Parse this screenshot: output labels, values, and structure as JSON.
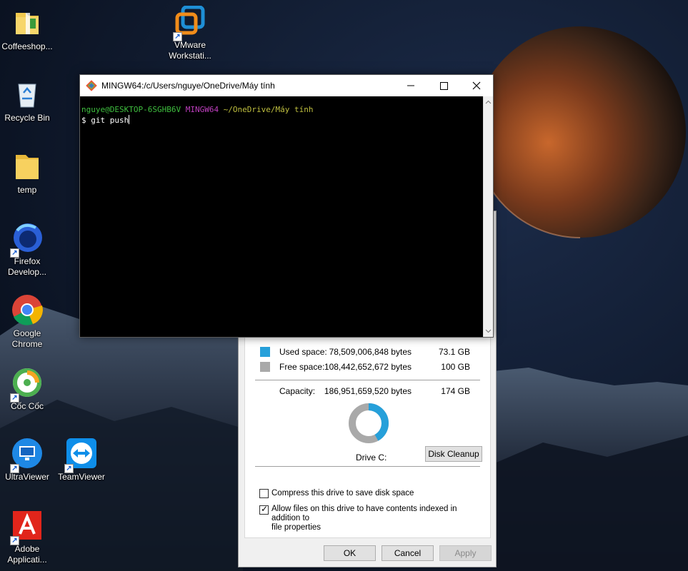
{
  "desktop": {
    "icons": [
      {
        "label": "Coffeeshop...",
        "icon": "folder-zip-icon"
      },
      {
        "label": "VMware\nWorkstati...",
        "icon": "vmware-icon"
      },
      {
        "label": "Recycle Bin",
        "icon": "recycle-bin-icon"
      },
      {
        "label": "temp",
        "icon": "folder-icon"
      },
      {
        "label": "Firefox\nDevelop...",
        "icon": "firefox-icon"
      },
      {
        "label": "Google\nChrome",
        "icon": "chrome-icon"
      },
      {
        "label": "Cốc Cốc",
        "icon": "coccoc-icon"
      },
      {
        "label": "UltraViewer",
        "icon": "ultraviewer-icon"
      },
      {
        "label": "TeamViewer",
        "icon": "teamviewer-icon"
      },
      {
        "label": "Adobe\nApplicati...",
        "icon": "adobe-icon"
      }
    ]
  },
  "terminal": {
    "title": "MINGW64:/c/Users/nguye/OneDrive/Máy tính",
    "prompt_user": "nguye@DESKTOP-6SGHB6V",
    "prompt_env": "MINGW64",
    "prompt_path": "~/OneDrive/Máy tính",
    "command_line": "$ git push",
    "colors": {
      "user": "#3fbf3f",
      "env": "#bf3fbf",
      "path": "#bfbf3f",
      "text": "#ffffff"
    }
  },
  "properties": {
    "used": {
      "label": "Used space:",
      "bytes": "78,509,006,848 bytes",
      "gb": "73.1 GB",
      "color": "#26a0da"
    },
    "free": {
      "label": "Free space:",
      "bytes": "108,442,652,672 bytes",
      "gb": "100 GB",
      "color": "#a9a9a9"
    },
    "capacity": {
      "label": "Capacity:",
      "bytes": "186,951,659,520 bytes",
      "gb": "174 GB"
    },
    "used_fraction": 0.42,
    "drive_label": "Drive C:",
    "cleanup_button": "Disk Cleanup",
    "compress_label": "Compress this drive to save disk space",
    "compress_checked": false,
    "index_label": "Allow files on this drive to have contents indexed in addition to\nfile properties",
    "index_checked": true,
    "ok": "OK",
    "cancel": "Cancel",
    "apply": "Apply"
  }
}
